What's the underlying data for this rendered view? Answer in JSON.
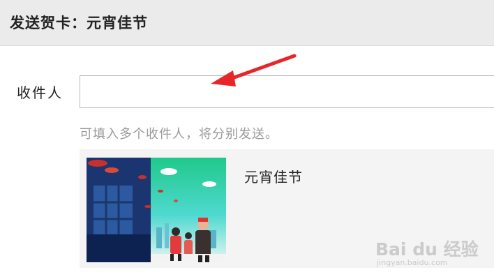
{
  "header": {
    "title": "发送贺卡：元宵佳节"
  },
  "form": {
    "recipient_label": "收件人",
    "recipient_value": "",
    "recipient_placeholder": "",
    "hint": "可填入多个收件人，将分别发送。"
  },
  "card": {
    "name": "元宵佳节",
    "image": "lantern-festival-card-illustration"
  },
  "annotation": {
    "arrow_color": "#e8262a",
    "icon": "red-arrow-icon"
  },
  "watermark": {
    "logo": "Bai du 经验",
    "url": "jingyan.baidu.com"
  },
  "colors": {
    "header_bg": "#ebebeb",
    "panel_bg": "#f4f4f5",
    "hint_text": "#9a9a9a"
  }
}
